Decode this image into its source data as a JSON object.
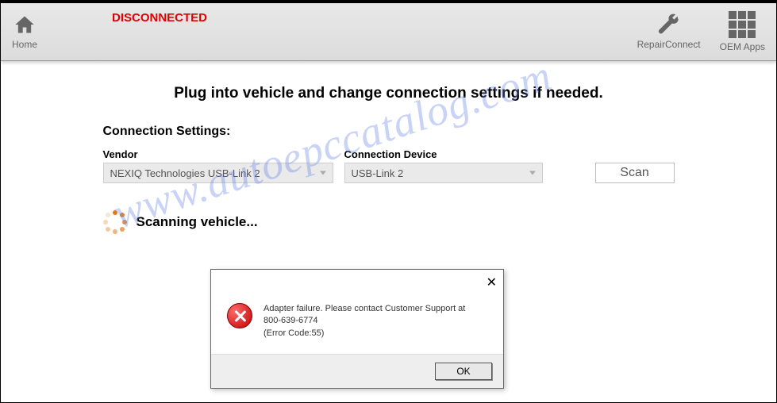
{
  "header": {
    "status": "DISCONNECTED",
    "home_label": "Home",
    "repair_label": "RepairConnect",
    "oem_label": "OEM Apps"
  },
  "main": {
    "instruction": "Plug into vehicle and change connection settings if needed.",
    "settings_heading": "Connection Settings:",
    "vendor_label": "Vendor",
    "vendor_value": "NEXIQ Technologies USB-Link 2",
    "device_label": "Connection Device",
    "device_value": "USB-Link 2",
    "scan_label": "Scan",
    "scanning_text": "Scanning vehicle..."
  },
  "dialog": {
    "message_line1": "Adapter failure.  Please contact Customer Support at",
    "message_line2": "800-639-6774",
    "message_line3": "(Error Code:55)",
    "ok_label": "OK"
  },
  "watermark": "www.autoepccatalog.com"
}
